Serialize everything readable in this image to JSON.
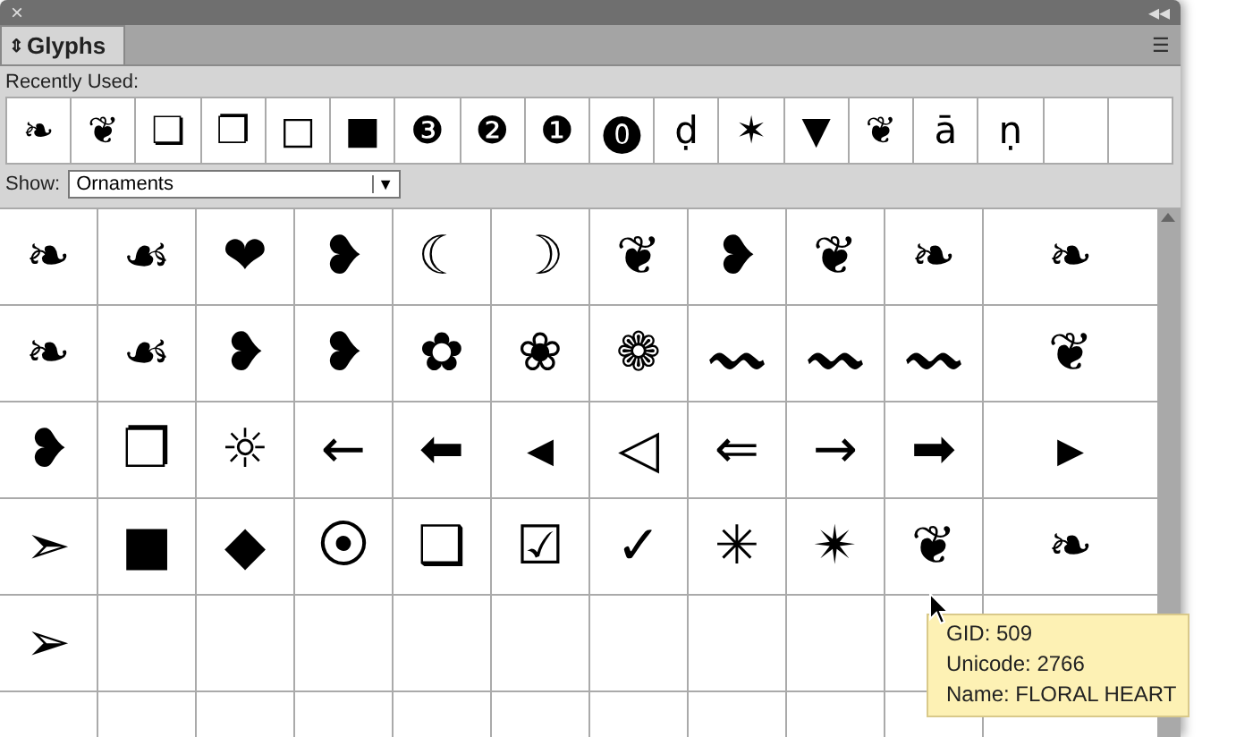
{
  "panel": {
    "close": "×",
    "collapse": "◂◂",
    "tab": {
      "icon": "⇕",
      "label": "Glyphs",
      "selected": true
    },
    "menu": "☰"
  },
  "recently_used": {
    "label": "Recently Used:",
    "glyphs": [
      "❧",
      "❦",
      "❏",
      "❐",
      "□",
      "■",
      "❸",
      "❷",
      "❶",
      "⓿",
      "ḍ",
      "✶",
      "▼",
      "❦",
      "ā",
      "ṇ"
    ]
  },
  "show": {
    "label": "Show:",
    "value": "Ornaments",
    "arrow": "▼"
  },
  "grid": {
    "rows": [
      [
        "❧",
        "☙",
        "❤",
        "❥",
        "☾",
        "☽",
        "❦",
        "❥",
        "❦",
        "❧",
        "❧"
      ],
      [
        "❧",
        "☙",
        "❥",
        "❥",
        "✿",
        "❀",
        "❁",
        "〰",
        "〰",
        "〰",
        "❦"
      ],
      [
        "❥",
        "❐",
        "☼",
        "←",
        "⬅",
        "◂",
        "◁",
        "⇐",
        "→",
        "➡",
        "▸"
      ],
      [
        "➣",
        "■",
        "◆",
        "⦿",
        "❑",
        "☑",
        "✓",
        "✳",
        "✴",
        "❦",
        "❧"
      ],
      [
        "➢"
      ],
      []
    ]
  },
  "tooltip": {
    "lines": [
      "GID: 509",
      "Unicode: 2766",
      "Name: FLORAL HEART"
    ]
  }
}
